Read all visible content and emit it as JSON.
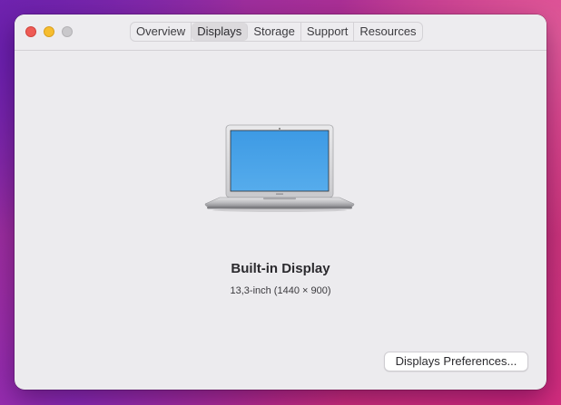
{
  "window": {
    "tabs": [
      {
        "label": "Overview",
        "active": false
      },
      {
        "label": "Displays",
        "active": true
      },
      {
        "label": "Storage",
        "active": false
      },
      {
        "label": "Support",
        "active": false
      },
      {
        "label": "Resources",
        "active": false
      }
    ],
    "traffic_lights": {
      "close_color": "#ee5b55",
      "minimize_color": "#f6bd2f",
      "zoom_color": "#c9c8cb"
    }
  },
  "display": {
    "icon": "laptop-icon",
    "name": "Built-in Display",
    "spec": "13,3-inch (1440 × 900)"
  },
  "actions": {
    "preferences_label": "Displays Preferences..."
  },
  "colors": {
    "screen_blue": "#4aa3e6",
    "window_bg": "#ecebee"
  }
}
